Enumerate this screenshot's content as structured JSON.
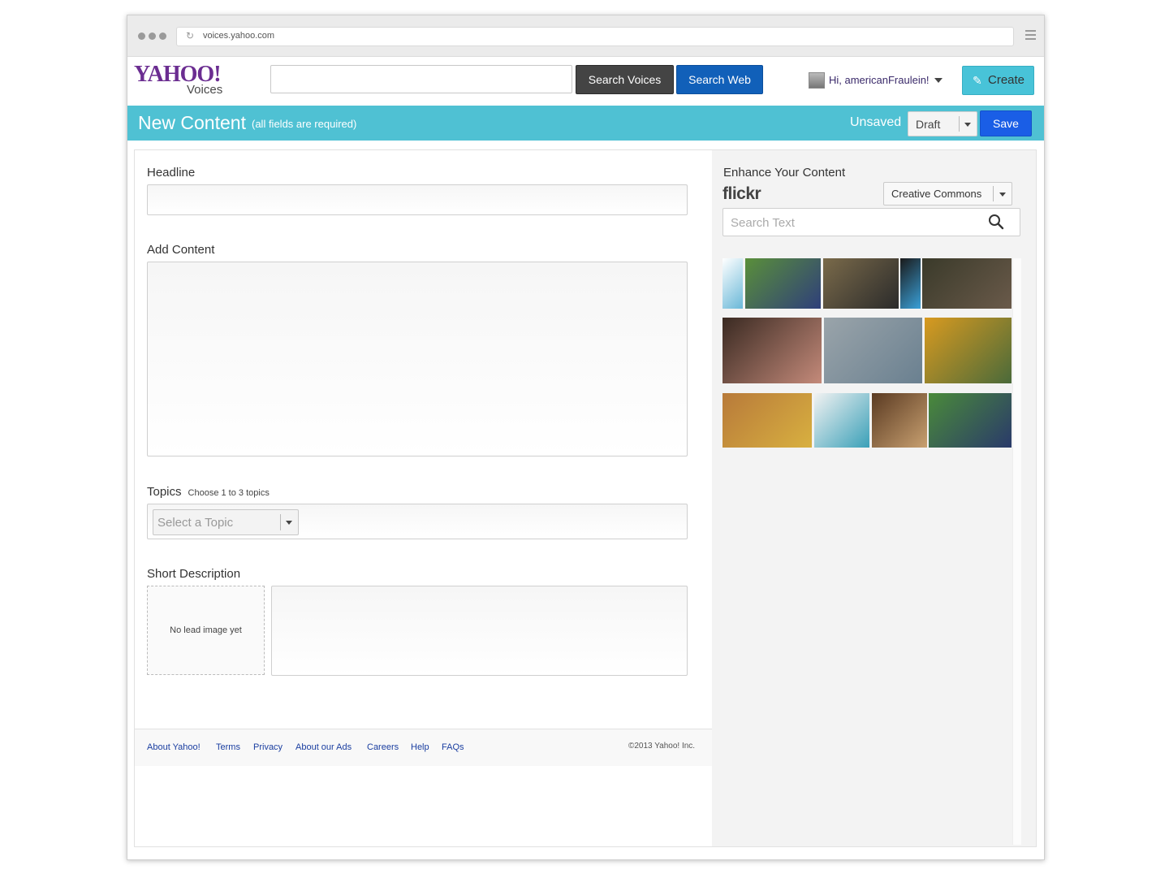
{
  "browser": {
    "url": "voices.yahoo.com"
  },
  "header": {
    "logo_yahoo": "YAHOO!",
    "logo_voices": "Voices",
    "search_placeholder": "",
    "search_voices_label": "Search Voices",
    "search_web_label": "Search Web",
    "greeting": "Hi, americanFraulein!",
    "create_label": "Create"
  },
  "toolbar": {
    "title": "New Content",
    "subtitle": "(all fields are required)",
    "status": "Unsaved",
    "draft_value": "Draft",
    "save_label": "Save"
  },
  "form": {
    "headline_label": "Headline",
    "content_label": "Add Content",
    "topics_label": "Topics",
    "topics_hint": "Choose 1 to 3 topics",
    "topic_placeholder": "Select a Topic",
    "short_desc_label": "Short Description",
    "no_lead_image": "No lead image yet"
  },
  "footer": {
    "links": [
      "About Yahoo!",
      "Terms",
      "Privacy",
      "About our Ads",
      "Careers",
      "Help",
      "FAQs"
    ],
    "copyright": "©2013  Yahoo! Inc."
  },
  "enhance": {
    "title": "Enhance Your Content",
    "flickr": "flickr",
    "license": "Creative Commons",
    "search_placeholder": "Search Text",
    "photos": [
      {
        "name": "welcome-sign-photo",
        "colors": [
          "#ffffff",
          "#6ab8d8"
        ]
      },
      {
        "name": "football-game-photo",
        "colors": [
          "#5a8f3a",
          "#2f3f7a"
        ]
      },
      {
        "name": "basketball-hoop-photo",
        "colors": [
          "#7a6a4a",
          "#2b2b2b"
        ]
      },
      {
        "name": "poster-photo",
        "colors": [
          "#1a1a1a",
          "#3aa0d8"
        ]
      },
      {
        "name": "children-sitting-photo",
        "colors": [
          "#3a3a2a",
          "#6a5a4a"
        ]
      },
      {
        "name": "mother-child-photo",
        "colors": [
          "#3a2a22",
          "#c48a7a"
        ]
      },
      {
        "name": "basketball-court-photo",
        "colors": [
          "#9aa4aa",
          "#6a8090"
        ]
      },
      {
        "name": "school-bus-photo",
        "colors": [
          "#d89a20",
          "#4a6a3a"
        ]
      },
      {
        "name": "movie-poster-photo",
        "colors": [
          "#b87a3a",
          "#d8b040"
        ]
      },
      {
        "name": "earrings-photo",
        "colors": [
          "#f2f2f2",
          "#3aa0b8"
        ]
      },
      {
        "name": "church-interior-photo",
        "colors": [
          "#5a3a22",
          "#c8a070"
        ]
      },
      {
        "name": "youth-football-photo",
        "colors": [
          "#4a8a3a",
          "#2a3a6a"
        ]
      }
    ]
  }
}
